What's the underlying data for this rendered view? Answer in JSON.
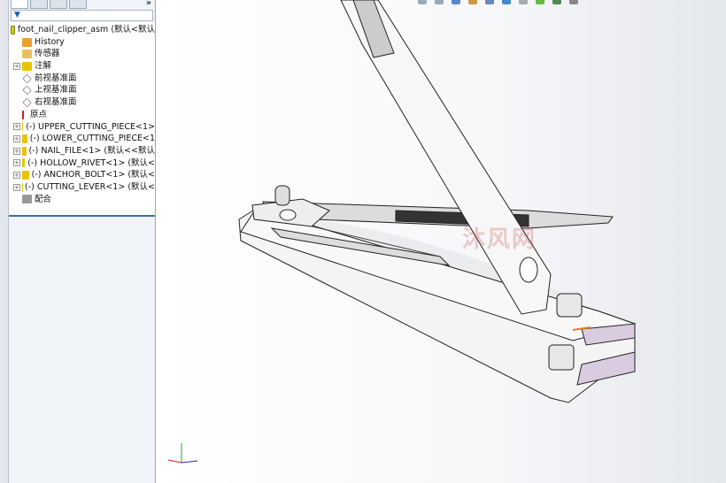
{
  "tree": {
    "root": "foot_nail_clipper_asm  (默认<默认",
    "items": [
      {
        "label": "History",
        "expand": false,
        "icon": "history-icon"
      },
      {
        "label": "传感器",
        "expand": false,
        "icon": "sensor-icon"
      },
      {
        "label": "注解",
        "expand": true,
        "icon": "annotation-icon"
      },
      {
        "label": "前视基准面",
        "expand": false,
        "icon": "plane-icon"
      },
      {
        "label": "上视基准面",
        "expand": false,
        "icon": "plane-icon"
      },
      {
        "label": "右视基准面",
        "expand": false,
        "icon": "plane-icon"
      },
      {
        "label": "原点",
        "expand": false,
        "icon": "origin-icon"
      },
      {
        "label": "(-) UPPER_CUTTING_PIECE<1>",
        "expand": true,
        "icon": "part-icon"
      },
      {
        "label": "(-) LOWER_CUTTING_PIECE<1",
        "expand": true,
        "icon": "part-icon"
      },
      {
        "label": "(-) NAIL_FILE<1> (默认<<默认",
        "expand": true,
        "icon": "part-icon"
      },
      {
        "label": "(-) HOLLOW_RIVET<1> (默认<",
        "expand": true,
        "icon": "part-icon"
      },
      {
        "label": "(-) ANCHOR_BOLT<1> (默认<",
        "expand": true,
        "icon": "part-icon"
      },
      {
        "label": "(-) CUTTING_LEVER<1> (默认<",
        "expand": true,
        "icon": "part-icon"
      },
      {
        "label": "配合",
        "expand": false,
        "icon": "mates-icon"
      }
    ]
  },
  "panel": {
    "more": "»",
    "filter": "▼"
  },
  "watermark": "沐风网",
  "colors": {
    "part": "#e8c400",
    "accent": "#3a6fb0"
  }
}
